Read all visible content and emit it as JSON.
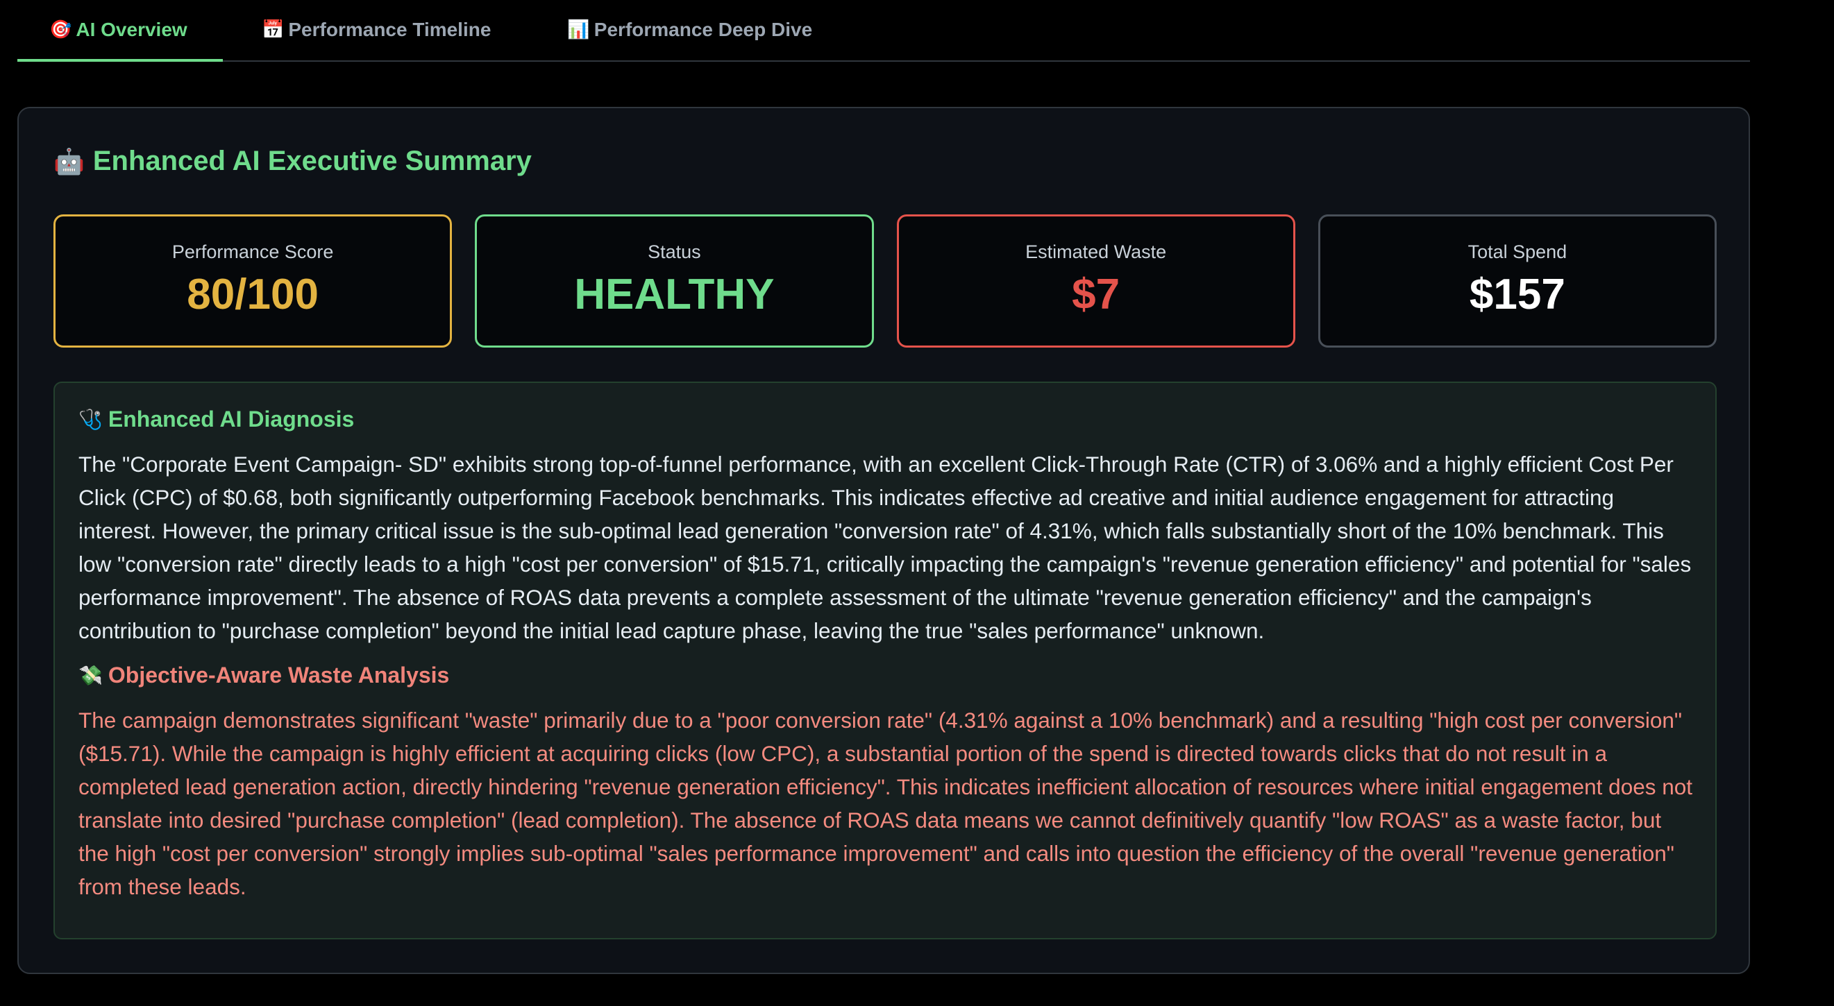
{
  "tabs": [
    {
      "icon": "🎯",
      "label": "AI Overview",
      "active": true
    },
    {
      "icon": "📅",
      "label": "Performance Timeline",
      "active": false
    },
    {
      "icon": "📊",
      "label": "Performance Deep Dive",
      "active": false
    }
  ],
  "summary": {
    "icon": "🤖",
    "title": "Enhanced AI Executive Summary"
  },
  "metrics": {
    "score": {
      "label": "Performance Score",
      "value": "80/100"
    },
    "status": {
      "label": "Status",
      "value": "HEALTHY"
    },
    "waste": {
      "label": "Estimated Waste",
      "value": "$7"
    },
    "spend": {
      "label": "Total Spend",
      "value": "$157"
    }
  },
  "diagnosis": {
    "icon": "🩺",
    "title": "Enhanced AI Diagnosis",
    "text": "The \"Corporate Event Campaign- SD\" exhibits strong top-of-funnel performance, with an excellent Click-Through Rate (CTR) of 3.06% and a highly efficient Cost Per Click (CPC) of $0.68, both significantly outperforming Facebook benchmarks. This indicates effective ad creative and initial audience engagement for attracting interest. However, the primary critical issue is the sub-optimal lead generation \"conversion rate\" of 4.31%, which falls substantially short of the 10% benchmark. This low \"conversion rate\" directly leads to a high \"cost per conversion\" of $15.71, critically impacting the campaign's \"revenue generation efficiency\" and potential for \"sales performance improvement\". The absence of ROAS data prevents a complete assessment of the ultimate \"revenue generation efficiency\" and the campaign's contribution to \"purchase completion\" beyond the initial lead capture phase, leaving the true \"sales performance\" unknown."
  },
  "waste_analysis": {
    "icon": "💸",
    "title": "Objective-Aware Waste Analysis",
    "text": "The campaign demonstrates significant \"waste\" primarily due to a \"poor conversion rate\" (4.31% against a 10% benchmark) and a resulting \"high cost per conversion\" ($15.71). While the campaign is highly efficient at acquiring clicks (low CPC), a substantial portion of the spend is directed towards clicks that do not result in a completed lead generation action, directly hindering \"revenue generation efficiency\". This indicates inefficient allocation of resources where initial engagement does not translate into desired \"purchase completion\" (lead completion). The absence of ROAS data means we cannot definitively quantify \"low ROAS\" as a waste factor, but the high \"cost per conversion\" strongly implies sub-optimal \"sales performance improvement\" and calls into question the efficiency of the overall \"revenue generation\" from these leads."
  },
  "colors": {
    "accent_green": "#6fdc8c",
    "score_yellow": "#e3b341",
    "waste_red": "#e5534b",
    "waste_text": "#f48b80",
    "card_bg": "#0d1117",
    "panel_bg": "#161f1f"
  }
}
